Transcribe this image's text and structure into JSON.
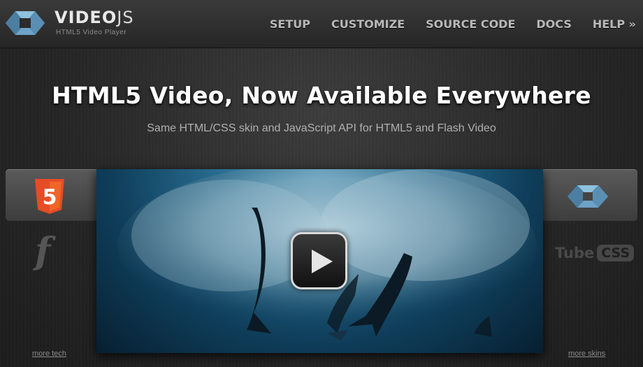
{
  "header": {
    "brand_main": "VIDEO",
    "brand_js": "JS",
    "tagline": "HTML5 Video Player",
    "nav": [
      {
        "label": "SETUP"
      },
      {
        "label": "CUSTOMIZE"
      },
      {
        "label": "SOURCE CODE"
      },
      {
        "label": "DOCS"
      },
      {
        "label": "HELP »"
      }
    ]
  },
  "hero": {
    "headline": "HTML5 Video, Now Available Everywhere",
    "subhead": "Same HTML/CSS skin and JavaScript API for HTML5 and Flash Video"
  },
  "tech": {
    "html5_badge_text": "5",
    "flash_glyph": "f",
    "tube_word": "Tube",
    "css_word": "CSS",
    "more_tech_label": "more tech",
    "more_skins_label": "more skins"
  },
  "colors": {
    "html5_orange": "#e44d26",
    "logo_blue": "#5b8fb1",
    "background": "#1f1f1f"
  },
  "icons": {
    "logo": "videojs-logo-icon",
    "play": "play-icon"
  }
}
